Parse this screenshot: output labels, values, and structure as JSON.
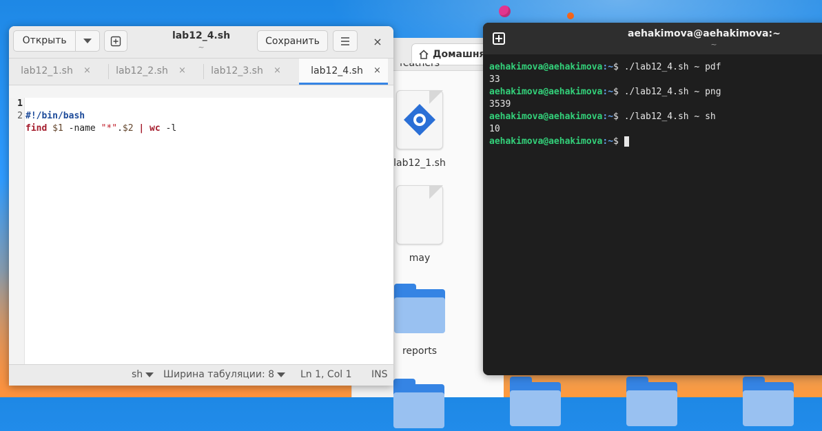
{
  "file_manager": {
    "home_label": "Домашняя",
    "partial_item_label": "feathers",
    "items": [
      {
        "label": "lab12_1.sh",
        "icon": "shell-script-icon"
      },
      {
        "label": "may",
        "icon": "text-document-icon"
      },
      {
        "label": "reports",
        "icon": "folder-icon"
      }
    ]
  },
  "editor": {
    "open_label": "Открыть",
    "title": "lab12_4.sh",
    "subtitle": "~",
    "save_label": "Сохранить",
    "close_glyph": "×",
    "tabs": [
      {
        "label": "lab12_1.sh",
        "active": false
      },
      {
        "label": "lab12_2.sh",
        "active": false
      },
      {
        "label": "lab12_3.sh",
        "active": false
      },
      {
        "label": "lab12_4.sh",
        "active": true
      }
    ],
    "tab_close_glyph": "×",
    "lines": [
      {
        "number": "1",
        "text": "#!/bin/bash"
      },
      {
        "number": "2",
        "text": "find $1 -name \"*\".$2 | wc -l"
      }
    ],
    "code": {
      "shebang": "#!/bin/bash",
      "kw_find": "find",
      "arg1": "$1",
      "opt_name": " -name ",
      "pattern": "\"*\"",
      "dot": ".",
      "arg2": "$2",
      "pipe": " | ",
      "kw_wc": "wc",
      "opt_l": " -l"
    },
    "status": {
      "language": "sh",
      "tab_width": "Ширина табуляции: 8",
      "position": "Ln 1, Col 1",
      "mode": "INS"
    }
  },
  "terminal": {
    "title": "aehakimova@aehakimova:~",
    "subtitle": "~",
    "prompt_user": "aehakimova@aehakimova",
    "prompt_path": ":~",
    "prompt_symbol": "$ ",
    "entries": [
      {
        "command": "./lab12_4.sh ~ pdf",
        "output": "33"
      },
      {
        "command": "./lab12_4.sh ~ png",
        "output": "3539"
      },
      {
        "command": "./lab12_4.sh ~ sh",
        "output": "10"
      }
    ]
  },
  "colors": {
    "accent": "#3584e4",
    "prompt_green": "#33d17a",
    "prompt_blue": "#62a0ea",
    "terminal_bg": "#1e1e1e"
  }
}
